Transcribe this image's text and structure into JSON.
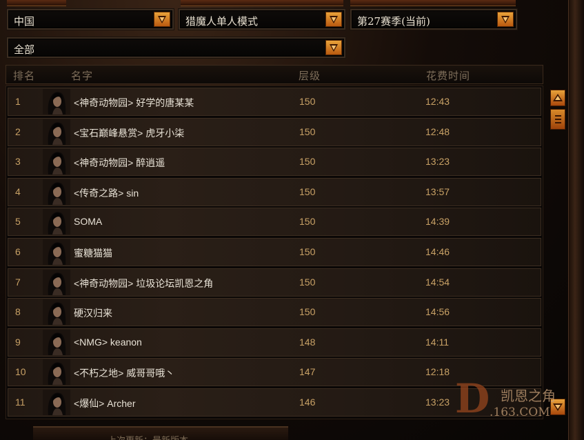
{
  "filters": {
    "region": "中国",
    "mode": "猎魔人单人模式",
    "season": "第27赛季(当前)",
    "class_filter": "全部"
  },
  "columns": {
    "rank": "排名",
    "name": "名字",
    "tier": "层级",
    "time": "花费时间"
  },
  "rows": [
    {
      "rank": "1",
      "name": "<神奇动物园> 好学的唐某某",
      "tier": "150",
      "time": "12:43"
    },
    {
      "rank": "2",
      "name": "<宝石巅峰悬赏> 虎牙小柒",
      "tier": "150",
      "time": "12:48"
    },
    {
      "rank": "3",
      "name": "<神奇动物园> 醉逍遥",
      "tier": "150",
      "time": "13:23"
    },
    {
      "rank": "4",
      "name": "<传奇之路> sin",
      "tier": "150",
      "time": "13:57"
    },
    {
      "rank": "5",
      "name": "SOMA",
      "tier": "150",
      "time": "14:39"
    },
    {
      "rank": "6",
      "name": "蜜糖猫猫",
      "tier": "150",
      "time": "14:46"
    },
    {
      "rank": "7",
      "name": "<神奇动物园> 垃圾论坛凯恩之角",
      "tier": "150",
      "time": "14:54"
    },
    {
      "rank": "8",
      "name": "硬汉归来",
      "tier": "150",
      "time": "14:56"
    },
    {
      "rank": "9",
      "name": "<NMG> keanon",
      "tier": "148",
      "time": "14:11"
    },
    {
      "rank": "10",
      "name": "<不朽之地> 威哥哥哦丶",
      "tier": "147",
      "time": "12:18"
    },
    {
      "rank": "11",
      "name": "<爆仙> Archer",
      "tier": "146",
      "time": "13:23"
    }
  ],
  "watermark": {
    "letter": "D",
    "site_name": "凯恩之角",
    "domain": ".163.COM"
  },
  "footer": {
    "text": "上次更新：最新版本"
  },
  "icons": {
    "dropdown": "chevron-down-icon",
    "scroll_up": "arrow-up-icon",
    "scroll_down": "arrow-down-icon",
    "avatar": "demon-hunter-portrait-icon"
  },
  "colors": {
    "accent": "#e08a25",
    "rank_text": "#c9a266",
    "name_text": "#e8e2d6",
    "header_text": "#7e6e5a"
  }
}
